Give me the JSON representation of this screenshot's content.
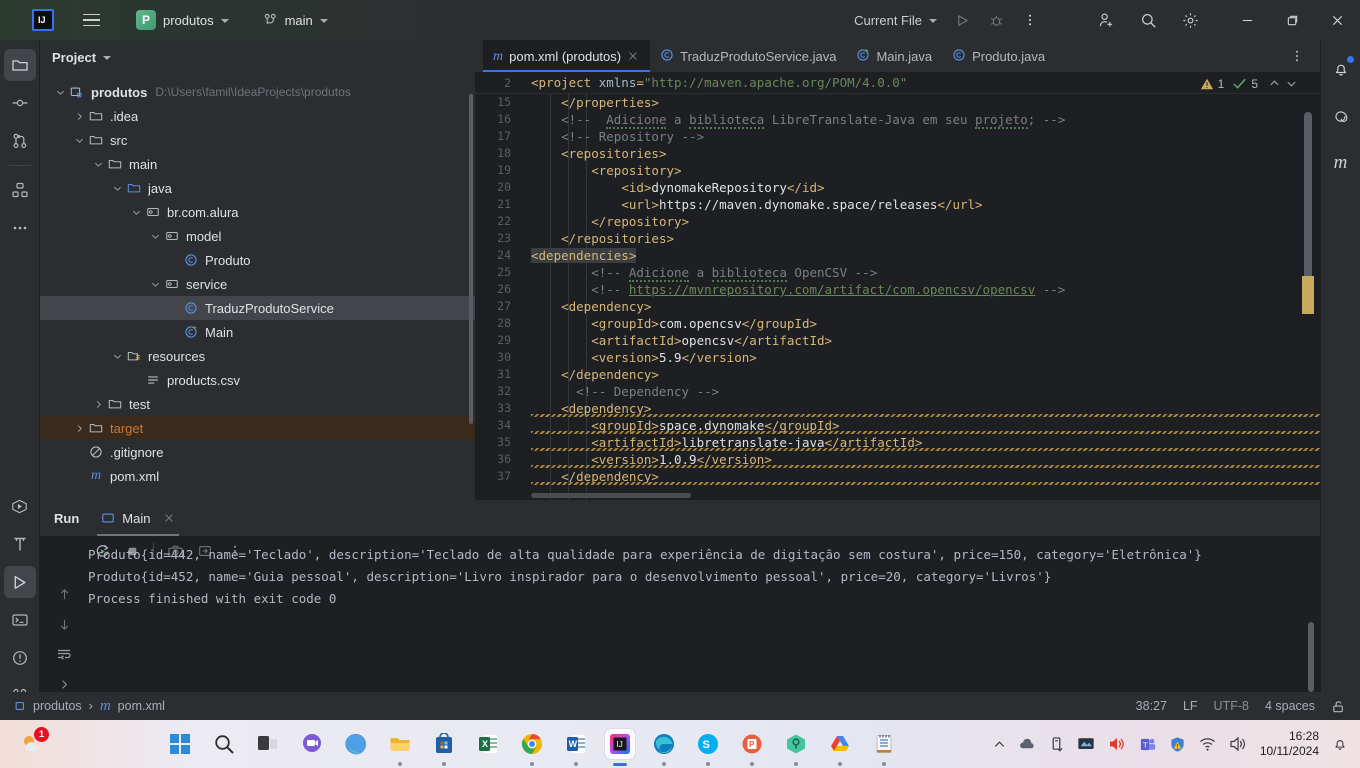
{
  "titlebar": {
    "menu_icon": "hamburger-icon",
    "project_badge": "P",
    "project_name": "produtos",
    "branch_icon": "git-branch-icon",
    "branch_name": "main",
    "run_config": "Current File",
    "run_icon": "run-icon",
    "debug_icon": "debug-icon",
    "more_icon": "more-vertical-icon",
    "share_icon": "add-user-icon",
    "search_icon": "search-icon",
    "settings_icon": "gear-icon",
    "minimize": "minimize-icon",
    "maximize": "maximize-icon",
    "close": "close-icon"
  },
  "left_strip": {
    "items": [
      {
        "name": "project-tool-window",
        "icon": "folder-icon",
        "active": true
      },
      {
        "name": "commit-tool-window",
        "icon": "commit-icon",
        "active": false
      },
      {
        "name": "pull-requests-tool-window",
        "icon": "pull-request-icon",
        "active": false
      },
      {
        "name": "structure-tool-window",
        "icon": "structure-icon",
        "active": false
      },
      {
        "name": "more-tool-windows",
        "icon": "more-horizontal-icon",
        "active": false
      }
    ],
    "bottom_items": [
      {
        "name": "run-anything",
        "icon": "run-dashboard-icon",
        "active": false
      },
      {
        "name": "build-tool-window",
        "icon": "hammer-icon",
        "active": false
      },
      {
        "name": "run-tool-window",
        "icon": "run-icon",
        "active": true
      },
      {
        "name": "terminal-tool-window",
        "icon": "terminal-icon",
        "active": false
      },
      {
        "name": "problems-tool-window",
        "icon": "warning-circle-icon",
        "active": false
      },
      {
        "name": "git-tool-window",
        "icon": "git-branch-icon",
        "active": false
      }
    ]
  },
  "right_strip": {
    "items": [
      {
        "name": "notifications",
        "icon": "bell-icon",
        "badge": true
      },
      {
        "name": "ai-assistant",
        "icon": "spiral-icon",
        "badge": false
      },
      {
        "name": "maven-tool-window",
        "icon": "maven-m-icon",
        "badge": false
      }
    ]
  },
  "project_panel": {
    "title": "Project",
    "dropdown_icon": "chevron-down-icon",
    "tree": [
      {
        "label": "produtos",
        "path": "D:\\Users\\famil\\IdeaProjects\\produtos",
        "icon": "module-icon",
        "indent": 0,
        "twist": "down",
        "bold": true,
        "state": "normal"
      },
      {
        "label": ".idea",
        "path": "",
        "icon": "folder-icon",
        "indent": 1,
        "twist": "right",
        "bold": false,
        "state": "normal"
      },
      {
        "label": "src",
        "path": "",
        "icon": "folder-icon",
        "indent": 1,
        "twist": "down",
        "bold": false,
        "state": "normal"
      },
      {
        "label": "main",
        "path": "",
        "icon": "folder-icon",
        "indent": 2,
        "twist": "down",
        "bold": false,
        "state": "normal"
      },
      {
        "label": "java",
        "path": "",
        "icon": "source-folder-icon",
        "indent": 3,
        "twist": "down",
        "bold": false,
        "state": "normal"
      },
      {
        "label": "br.com.alura",
        "path": "",
        "icon": "package-icon",
        "indent": 4,
        "twist": "down",
        "bold": false,
        "state": "normal"
      },
      {
        "label": "model",
        "path": "",
        "icon": "package-icon",
        "indent": 5,
        "twist": "down",
        "bold": false,
        "state": "normal"
      },
      {
        "label": "Produto",
        "path": "",
        "icon": "java-class-icon",
        "indent": 6,
        "twist": "none",
        "bold": false,
        "state": "normal"
      },
      {
        "label": "service",
        "path": "",
        "icon": "package-icon",
        "indent": 5,
        "twist": "down",
        "bold": false,
        "state": "normal"
      },
      {
        "label": "TraduzProdutoService",
        "path": "",
        "icon": "java-class-icon",
        "indent": 6,
        "twist": "none",
        "bold": false,
        "state": "selected"
      },
      {
        "label": "Main",
        "path": "",
        "icon": "java-runnable-class-icon",
        "indent": 6,
        "twist": "none",
        "bold": false,
        "state": "normal"
      },
      {
        "label": "resources",
        "path": "",
        "icon": "resources-folder-icon",
        "indent": 3,
        "twist": "down",
        "bold": false,
        "state": "normal"
      },
      {
        "label": "products.csv",
        "path": "",
        "icon": "csv-file-icon",
        "indent": 4,
        "twist": "none",
        "bold": false,
        "state": "normal"
      },
      {
        "label": "test",
        "path": "",
        "icon": "folder-icon",
        "indent": 2,
        "twist": "right",
        "bold": false,
        "state": "normal"
      },
      {
        "label": "target",
        "path": "",
        "icon": "folder-icon",
        "indent": 1,
        "twist": "right",
        "bold": false,
        "state": "excluded"
      },
      {
        "label": ".gitignore",
        "path": "",
        "icon": "gitignore-icon",
        "indent": 1,
        "twist": "none",
        "bold": false,
        "state": "normal"
      },
      {
        "label": "pom.xml",
        "path": "",
        "icon": "maven-m-icon",
        "indent": 1,
        "twist": "none",
        "bold": false,
        "state": "normal"
      }
    ]
  },
  "editor": {
    "tabs": [
      {
        "label": "pom.xml (produtos)",
        "icon": "maven-m-icon",
        "active": true,
        "closable": true
      },
      {
        "label": "TraduzProdutoService.java",
        "icon": "java-class-icon",
        "active": false,
        "closable": false
      },
      {
        "label": "Main.java",
        "icon": "java-runnable-class-icon",
        "active": false,
        "closable": false
      },
      {
        "label": "Produto.java",
        "icon": "java-class-icon",
        "active": false,
        "closable": false
      }
    ],
    "tab_options_icon": "more-vertical-icon",
    "sticky_line": {
      "number": "2",
      "text": "<project xmlns=\"http://maven.apache.org/POM/4.0.0\""
    },
    "inspection": {
      "warning_icon": "warning-triangle-icon",
      "warning_count": "1",
      "ok_icon": "checkmark-icon",
      "ok_count": "5",
      "prev_icon": "chevron-up-icon",
      "next_icon": "chevron-down-icon"
    },
    "lines": [
      {
        "n": "15",
        "code": "    </properties>"
      },
      {
        "n": "16",
        "code": "    <!--  Adicione a biblioteca LibreTranslate-Java em seu projeto; -->"
      },
      {
        "n": "17",
        "code": "    <!-- Repository -->"
      },
      {
        "n": "18",
        "code": "    <repositories>"
      },
      {
        "n": "19",
        "code": "        <repository>"
      },
      {
        "n": "20",
        "code": "            <id>dynomakeRepository</id>"
      },
      {
        "n": "21",
        "code": "            <url>https://maven.dynomake.space/releases</url>"
      },
      {
        "n": "22",
        "code": "        </repository>"
      },
      {
        "n": "23",
        "code": "    </repositories>"
      },
      {
        "n": "24",
        "code": "<dependencies>"
      },
      {
        "n": "25",
        "code": "        <!-- Adicione a biblioteca OpenCSV -->"
      },
      {
        "n": "26",
        "code": "        <!-- https://mvnrepository.com/artifact/com.opencsv/opencsv -->"
      },
      {
        "n": "27",
        "code": "    <dependency>"
      },
      {
        "n": "28",
        "code": "        <groupId>com.opencsv</groupId>"
      },
      {
        "n": "29",
        "code": "        <artifactId>opencsv</artifactId>"
      },
      {
        "n": "30",
        "code": "        <version>5.9</version>"
      },
      {
        "n": "31",
        "code": "    </dependency>"
      },
      {
        "n": "32",
        "code": "      <!-- Dependency -->"
      },
      {
        "n": "33",
        "code": "    <dependency>"
      },
      {
        "n": "34",
        "code": "        <groupId>space.dynomake</groupId>"
      },
      {
        "n": "35",
        "code": "        <artifactId>libretranslate-java</artifactId>"
      },
      {
        "n": "36",
        "code": "        <version>1.0.9</version>"
      },
      {
        "n": "37",
        "code": "    </dependency>"
      }
    ]
  },
  "run_panel": {
    "title": "Run",
    "tab_label": "Main",
    "tab_icon": "run-config-icon",
    "tab_close_icon": "close-icon",
    "toolbar": [
      {
        "name": "rerun-button",
        "icon": "rerun-icon"
      },
      {
        "name": "stop-button",
        "icon": "stop-icon"
      },
      {
        "name": "screenshot-button",
        "icon": "camera-icon"
      },
      {
        "name": "export-button",
        "icon": "export-icon"
      },
      {
        "name": "more-options-button",
        "icon": "more-vertical-icon"
      }
    ],
    "side_toolbar": [
      {
        "name": "scroll-up-button",
        "icon": "arrow-up-icon"
      },
      {
        "name": "scroll-down-button",
        "icon": "arrow-down-icon"
      },
      {
        "name": "soft-wrap-button",
        "icon": "soft-wrap-icon"
      },
      {
        "name": "expand-button",
        "icon": "chevron-right-icon"
      }
    ],
    "console_lines": [
      "Produto{id=442, name='Teclado', description='Teclado de alta qualidade para experiência de digitação sem costura', price=150, category='Eletrônica'}",
      "Produto{id=452, name='Guia pessoal', description='Livro inspirador para o desenvolvimento pessoal', price=20, category='Livros'}",
      "",
      "Process finished with exit code 0"
    ]
  },
  "statusbar": {
    "breadcrumb_project": "produtos",
    "breadcrumb_separator": "›",
    "breadcrumb_file": "pom.xml",
    "breadcrumb_file_icon": "maven-m-icon",
    "caret_position": "38:27",
    "line_separator": "LF",
    "encoding": "UTF-8",
    "indent": "4 spaces",
    "lock_icon": "unlocked-icon"
  },
  "taskbar": {
    "weather_badge": "1",
    "apps": [
      {
        "name": "start-button",
        "icon": "windows-icon",
        "running": false,
        "active": false
      },
      {
        "name": "search-taskbar",
        "icon": "search-icon",
        "running": false,
        "active": false
      },
      {
        "name": "task-view",
        "icon": "task-view-icon",
        "running": false,
        "active": false
      },
      {
        "name": "teams-chat",
        "icon": "chat-icon",
        "running": false,
        "active": false
      },
      {
        "name": "copilot",
        "icon": "copilot-icon",
        "running": false,
        "active": false
      },
      {
        "name": "file-explorer",
        "icon": "folder-icon",
        "running": true,
        "active": false
      },
      {
        "name": "microsoft-store",
        "icon": "store-icon",
        "running": true,
        "active": false
      },
      {
        "name": "excel",
        "icon": "excel-icon",
        "running": false,
        "active": false
      },
      {
        "name": "chrome",
        "icon": "chrome-icon",
        "running": true,
        "active": false
      },
      {
        "name": "word",
        "icon": "word-icon",
        "running": true,
        "active": false
      },
      {
        "name": "intellij-idea",
        "icon": "intellij-icon",
        "running": true,
        "active": true
      },
      {
        "name": "edge",
        "icon": "edge-icon",
        "running": true,
        "active": false
      },
      {
        "name": "skype",
        "icon": "skype-icon",
        "running": true,
        "active": false
      },
      {
        "name": "powerpoint",
        "icon": "powerpoint-icon",
        "running": true,
        "active": false
      },
      {
        "name": "keeper",
        "icon": "keeper-icon",
        "running": true,
        "active": false
      },
      {
        "name": "drive",
        "icon": "drive-icon",
        "running": true,
        "active": false
      },
      {
        "name": "notepad",
        "icon": "notepad-icon",
        "running": true,
        "active": false
      }
    ],
    "tray": [
      {
        "name": "show-hidden-icons",
        "icon": "chevron-up-icon"
      },
      {
        "name": "onedrive-tray",
        "icon": "cloud-icon"
      },
      {
        "name": "usb-tray",
        "icon": "usb-icon"
      },
      {
        "name": "display-tray",
        "icon": "monitor-icon"
      },
      {
        "name": "volume-tray",
        "icon": "speaker-icon"
      },
      {
        "name": "teams-tray",
        "icon": "teams-icon"
      },
      {
        "name": "defender-tray",
        "icon": "shield-warning-icon"
      },
      {
        "name": "network-tray",
        "icon": "wifi-icon"
      },
      {
        "name": "sound-tray",
        "icon": "volume-icon"
      }
    ],
    "time": "16:28",
    "date": "10/11/2024",
    "notification_icon": "bell-icon"
  },
  "colors": {
    "accent": "#3574f0",
    "warning": "#c9a95c",
    "ok": "#5fad65",
    "excluded": "#cc7832",
    "bg": "#1e1f22",
    "panel": "#2b2d30"
  }
}
